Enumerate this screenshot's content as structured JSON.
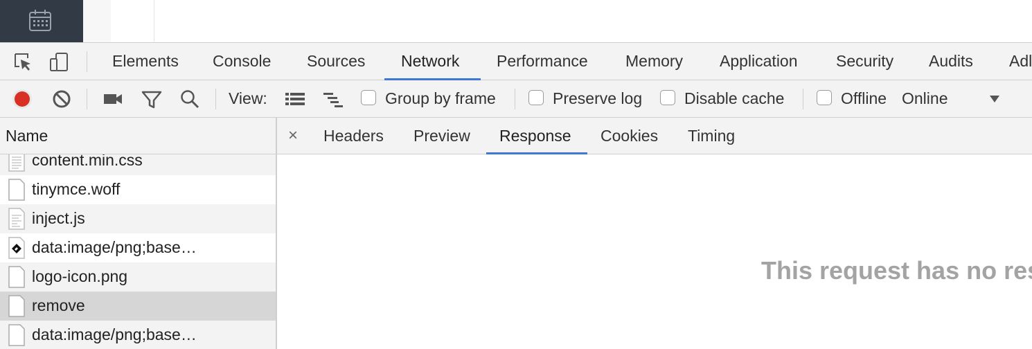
{
  "devtools_tabs": [
    {
      "label": "Elements"
    },
    {
      "label": "Console"
    },
    {
      "label": "Sources"
    },
    {
      "label": "Network",
      "active": true
    },
    {
      "label": "Performance"
    },
    {
      "label": "Memory"
    },
    {
      "label": "Application"
    },
    {
      "label": "Security"
    },
    {
      "label": "Audits"
    },
    {
      "label": "Adl"
    }
  ],
  "toolbar": {
    "view_label": "View:",
    "group_by_frame": {
      "label": "Group by frame",
      "checked": false
    },
    "preserve_log": {
      "label": "Preserve log",
      "checked": false
    },
    "disable_cache": {
      "label": "Disable cache",
      "checked": false
    },
    "offline": {
      "label": "Offline",
      "checked": false
    },
    "throttling_value": "Online",
    "record_color": "#d93025"
  },
  "requests": {
    "column_header": "Name",
    "rows": [
      {
        "name": "content.min.css",
        "icon": "stylesheet-file-icon"
      },
      {
        "name": "tinymce.woff",
        "icon": "blank-file-icon"
      },
      {
        "name": "inject.js",
        "icon": "script-file-icon"
      },
      {
        "name": "data:image/png;base…",
        "icon": "image-file-icon"
      },
      {
        "name": "logo-icon.png",
        "icon": "blank-file-icon"
      },
      {
        "name": "remove",
        "icon": "blank-file-icon",
        "selected": true
      },
      {
        "name": "data:image/png;base…",
        "icon": "blank-file-icon"
      }
    ]
  },
  "detail": {
    "close_symbol": "×",
    "tabs": [
      {
        "label": "Headers"
      },
      {
        "label": "Preview"
      },
      {
        "label": "Response",
        "active": true
      },
      {
        "label": "Cookies"
      },
      {
        "label": "Timing"
      }
    ],
    "empty_message": "This request has no res"
  },
  "colors": {
    "accent": "#3c78d8",
    "selected_row": "#d6d6d6",
    "stripe_row": "#f3f3f3"
  }
}
